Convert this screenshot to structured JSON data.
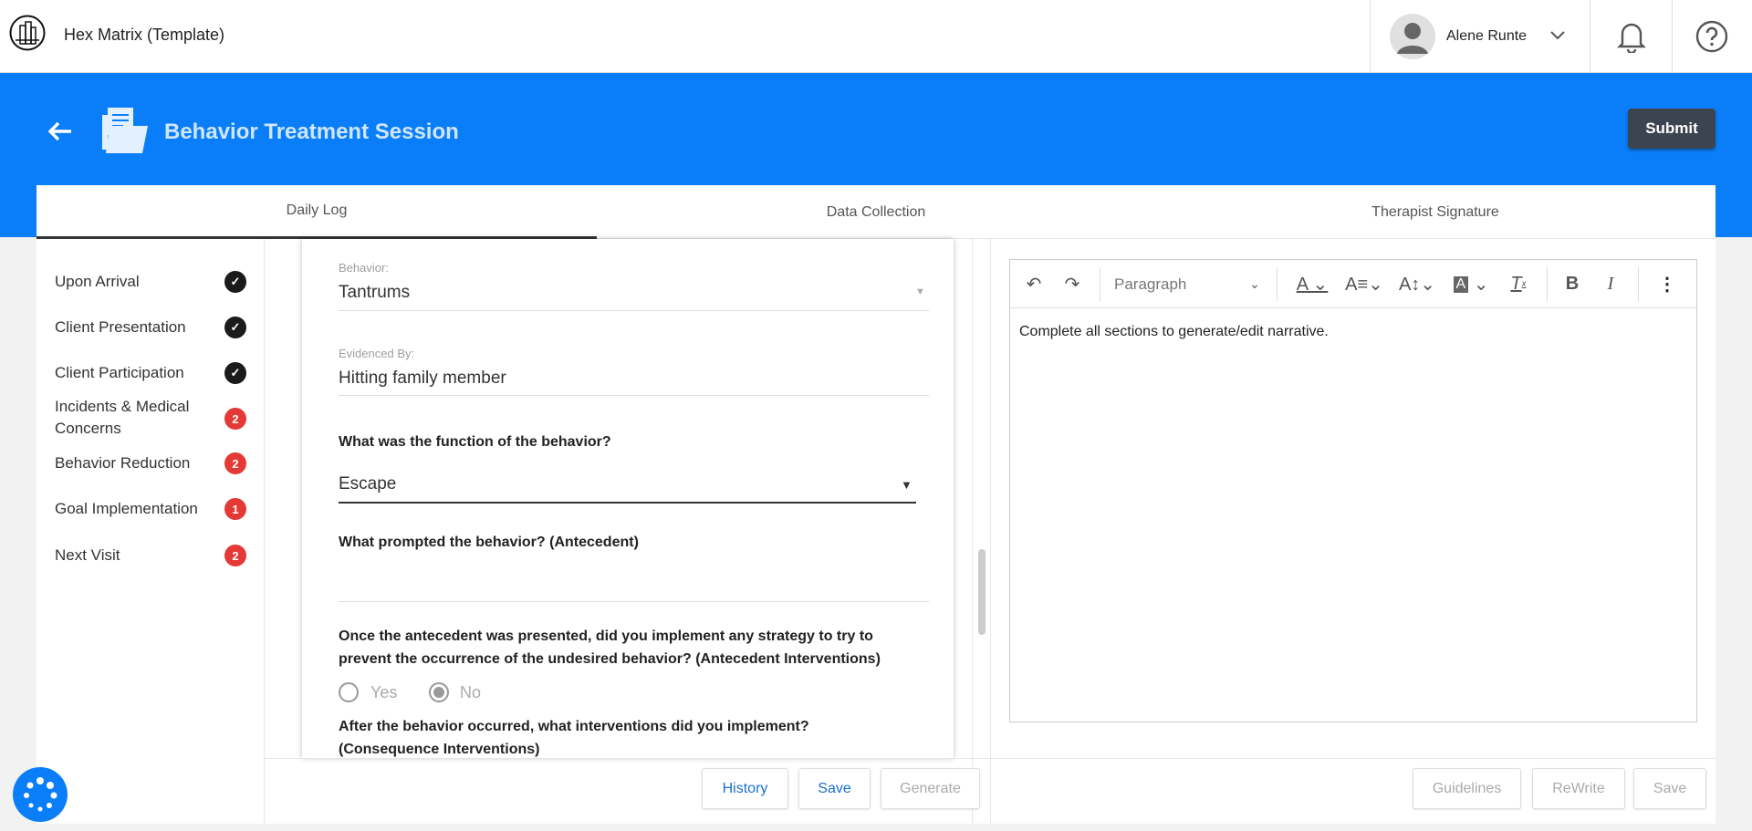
{
  "app": {
    "title": "Hex Matrix (Template)",
    "user_name": "Alene Runte"
  },
  "header": {
    "title": "Behavior Treatment Session",
    "submit_label": "Submit"
  },
  "tabs": [
    {
      "label": "Daily Log",
      "active": true
    },
    {
      "label": "Data Collection"
    },
    {
      "label": "Therapist Signature"
    }
  ],
  "sidebar": {
    "items": [
      {
        "label": "Upon Arrival",
        "status": "complete"
      },
      {
        "label": "Client Presentation",
        "status": "complete"
      },
      {
        "label": "Client Participation",
        "status": "complete"
      },
      {
        "label": "Incidents & Medical Concerns",
        "badge": "2"
      },
      {
        "label": "Behavior Reduction",
        "badge": "2"
      },
      {
        "label": "Goal Implementation",
        "badge": "1"
      },
      {
        "label": "Next Visit",
        "badge": "2"
      }
    ]
  },
  "form": {
    "behavior_label": "Behavior:",
    "behavior_value": "Tantrums",
    "evidenced_label": "Evidenced By:",
    "evidenced_value": "Hitting family member",
    "function_question": "What was the function of the behavior?",
    "function_value": "Escape",
    "antecedent_question": "What prompted the behavior? (Antecedent)",
    "antecedent_value": "",
    "intervention_question": "Once the antecedent was presented, did you implement any strategy to try to prevent the occurrence of the undesired behavior? (Antecedent Interventions)",
    "radio_yes": "Yes",
    "radio_no": "No",
    "radio_selected": "No",
    "consequence_question": "After the behavior occurred, what interventions did you implement? (Consequence Interventions)"
  },
  "form_footer": {
    "history": "History",
    "save": "Save",
    "generate": "Generate"
  },
  "editor": {
    "block_format": "Paragraph",
    "placeholder_text": "Complete all sections to generate/edit narrative.",
    "buttons": {
      "guidelines": "Guidelines",
      "rewrite": "ReWrite",
      "save": "Save"
    }
  },
  "colors": {
    "brand_blue": "#0a7ef8",
    "submit": "#3d4451",
    "badge_red": "#e53935",
    "link_blue": "#1a6fd1"
  }
}
